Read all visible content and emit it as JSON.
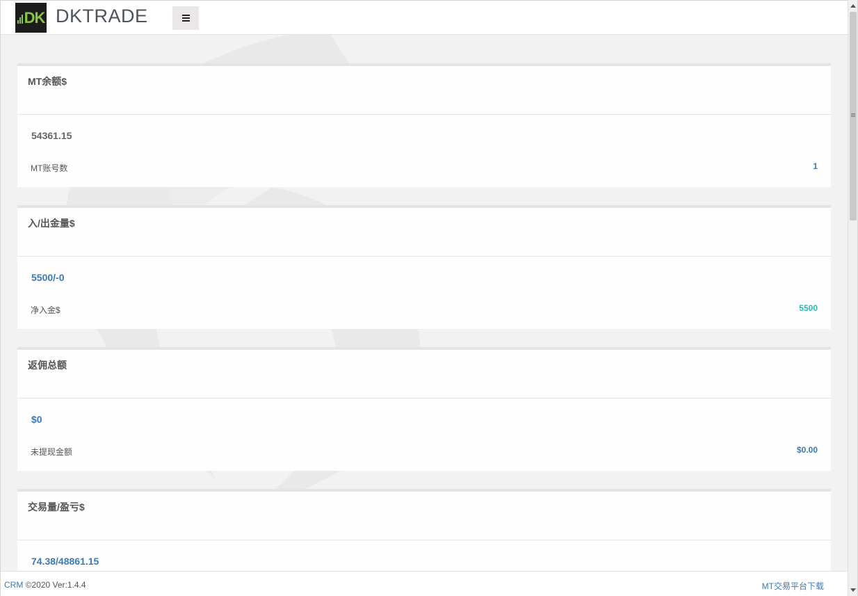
{
  "header": {
    "logo_text": "DK",
    "brand": "DKTRADE",
    "menu_icon": "hamburger-menu-icon"
  },
  "cards": [
    {
      "title": "MT余额$",
      "value": "54361.15",
      "label": "MT账号数",
      "stat": "1"
    },
    {
      "title": "入/出金量$",
      "value": "5500/-0",
      "label": "净入金$",
      "stat": "5500"
    },
    {
      "title": "返佣总额",
      "value": "$0",
      "label": "未提现金额",
      "stat": "$0.00"
    },
    {
      "title": "交易量/盈亏$",
      "value": "74.38/48861.15"
    }
  ],
  "footer": {
    "crm_link": "CRM",
    "copyright": " ©2020 Ver:1.4.4",
    "download_link": "MT交易平台下载"
  },
  "colors": {
    "accent_blue": "#3a7ab8",
    "teal": "#2ab8b0",
    "logo_green": "#8bc34a"
  }
}
